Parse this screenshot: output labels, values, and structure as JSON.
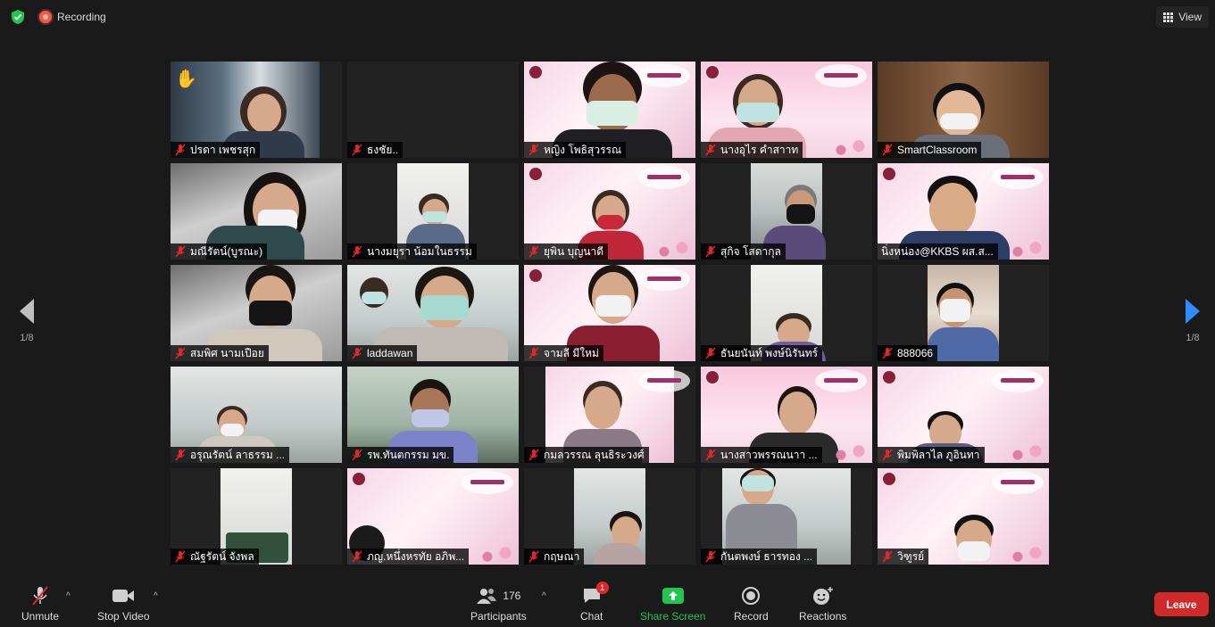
{
  "top": {
    "recording_label": "Recording",
    "view_label": "View"
  },
  "pager": {
    "left": "1/8",
    "right": "1/8"
  },
  "tiles": [
    {
      "name": "ปรดา  เพชรสุก"
    },
    {
      "name": "ธงชัย.."
    },
    {
      "name": "หญิง โพธิสุวรรณ"
    },
    {
      "name": "นางอุไร คำสาาท"
    },
    {
      "name": "SmartClassroom"
    },
    {
      "name": "มณีรัตน์(บูรณะ)"
    },
    {
      "name": "นางมยุรา น้อมในธรรม"
    },
    {
      "name": "ยุพิน บุญนาดี"
    },
    {
      "name": "สุกิจ โสดากุล"
    },
    {
      "name": "นิ่งหน่อง@KKBS ผส.ส..."
    },
    {
      "name": "สมพิศ นามเปือย"
    },
    {
      "name": "laddawan"
    },
    {
      "name": "จามลี มีใหม่"
    },
    {
      "name": "ธันยนันท์ พงษ์นิรันทร์"
    },
    {
      "name": "888066"
    },
    {
      "name": "อรุณรัตน์  ลาธรรม ..."
    },
    {
      "name": "รพ.ทันตกรรม มข."
    },
    {
      "name": "กมลวรรณ  ลุนธิระวงศ์"
    },
    {
      "name": "นางสาวพรรณนาา ..."
    },
    {
      "name": "พิมพิลาไล ภูอินทา"
    },
    {
      "name": "ณัฐรัตน์ จังพล"
    },
    {
      "name": "ภญ.หนึ่งหรทัย  อภิพ..."
    },
    {
      "name": "กฤษณา"
    },
    {
      "name": "กันตพงษ์ ธารทอง ..."
    },
    {
      "name": "วิฑูรย์"
    }
  ],
  "toolbar": {
    "unmute": "Unmute",
    "stop_video": "Stop Video",
    "participants": "Participants",
    "participants_count": "176",
    "chat": "Chat",
    "chat_badge": "1",
    "share_screen": "Share Screen",
    "record": "Record",
    "reactions": "Reactions",
    "leave": "Leave"
  },
  "colors": {
    "accent_blue": "#2d8cff",
    "share_green": "#23c552",
    "leave_red": "#d02a2a",
    "active_speaker": "#e9e34f",
    "muted_mic_red": "#e02828"
  }
}
